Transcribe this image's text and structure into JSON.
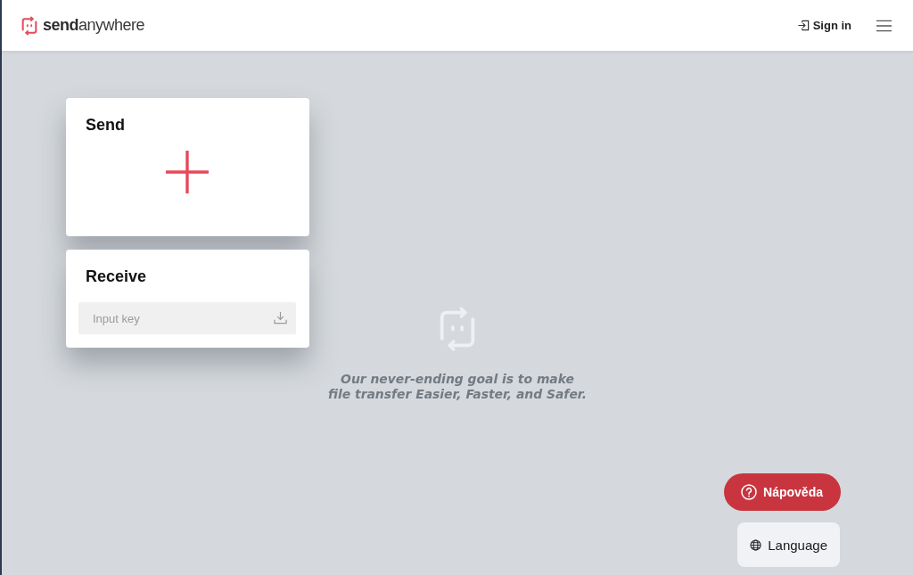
{
  "header": {
    "logo": "**send**anywhere",
    "sign_in": "Sign in"
  },
  "send_card": {
    "title": "Send"
  },
  "receive_card": {
    "title": "Receive",
    "key_field": {
      "placeholder": "Input key"
    }
  },
  "tagline": {
    "lines": [
      "Our never-ending goal is to make",
      "file transfer Easier, Faster, and Safer."
    ]
  },
  "help_button": {
    "label": "Nápověda"
  },
  "language_button": {
    "label": "Language"
  }
}
